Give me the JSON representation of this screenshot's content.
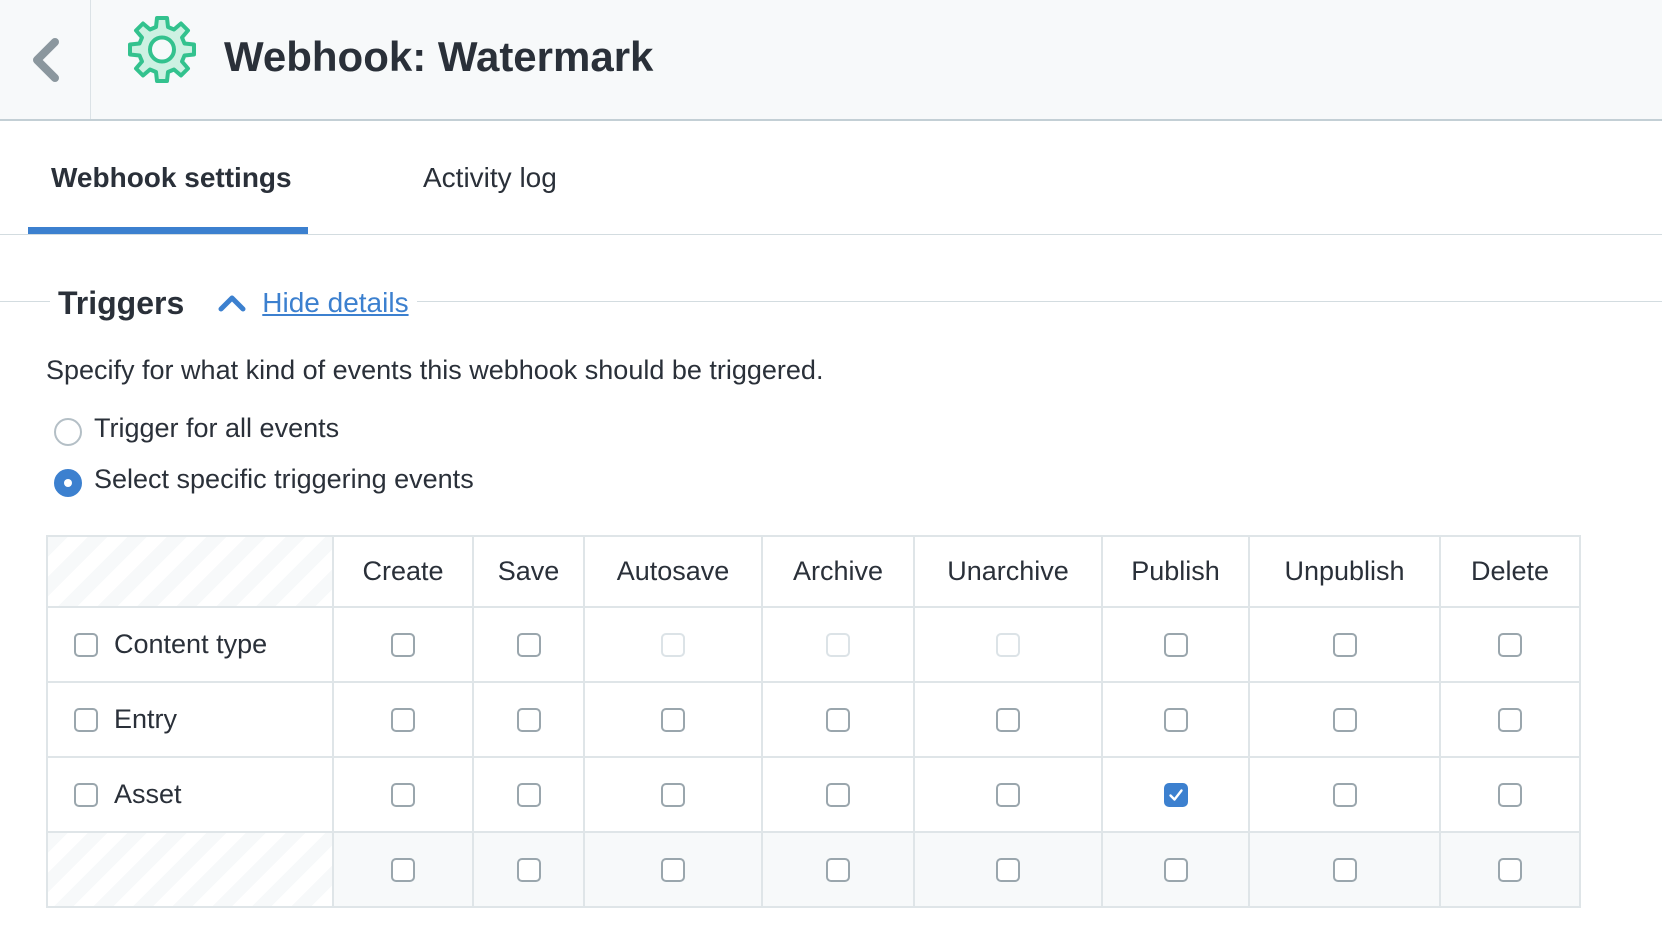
{
  "header": {
    "title": "Webhook: Watermark",
    "back_icon": "chevron-left-icon",
    "app_icon": "gear-icon",
    "accent": "#33c28e"
  },
  "tabs": [
    {
      "label": "Webhook settings",
      "active": true
    },
    {
      "label": "Activity log",
      "active": false
    }
  ],
  "triggers": {
    "title": "Triggers",
    "toggle_label": "Hide details",
    "description": "Specify for what kind of events this webhook should be triggered.",
    "options": [
      {
        "label": "Trigger for all events",
        "selected": false
      },
      {
        "label": "Select specific triggering events",
        "selected": true
      }
    ],
    "columns": [
      "Create",
      "Save",
      "Autosave",
      "Archive",
      "Unarchive",
      "Publish",
      "Unpublish",
      "Delete"
    ],
    "rows": [
      {
        "label": "Content type",
        "checked": false,
        "cells": [
          "unchecked",
          "unchecked",
          "disabled",
          "disabled",
          "disabled",
          "unchecked",
          "unchecked",
          "unchecked"
        ]
      },
      {
        "label": "Entry",
        "checked": false,
        "cells": [
          "unchecked",
          "unchecked",
          "unchecked",
          "unchecked",
          "unchecked",
          "unchecked",
          "unchecked",
          "unchecked"
        ]
      },
      {
        "label": "Asset",
        "checked": false,
        "cells": [
          "unchecked",
          "unchecked",
          "unchecked",
          "unchecked",
          "unchecked",
          "checked",
          "unchecked",
          "unchecked"
        ]
      },
      {
        "label": "",
        "checked": false,
        "cells": [
          "unchecked",
          "unchecked",
          "unchecked",
          "unchecked",
          "unchecked",
          "unchecked",
          "unchecked",
          "unchecked"
        ]
      }
    ],
    "accent": "#3c80cf"
  }
}
